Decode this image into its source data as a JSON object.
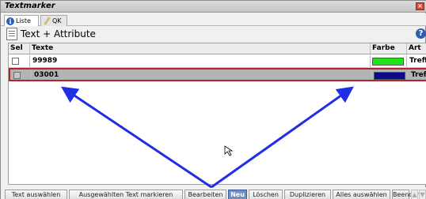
{
  "window": {
    "title": "Textmarker"
  },
  "tabs": [
    {
      "label": "Liste",
      "icon": "info-icon"
    },
    {
      "label": "QK",
      "icon": "pen-icon"
    }
  ],
  "header": {
    "title": "Text + Attribute"
  },
  "table": {
    "columns": [
      "Sel",
      "Texte",
      "Farbe",
      "Art"
    ],
    "rows": [
      {
        "text": "99989",
        "color": "#22e21a",
        "art": "Treffer",
        "selected": false
      },
      {
        "text": "03001",
        "color": "#0a0a8c",
        "art": "Treffer",
        "selected": true
      }
    ]
  },
  "toolbar": {
    "buttons": [
      {
        "label": "Text auswählen"
      },
      {
        "label": "Ausgewählten Text markieren"
      },
      {
        "label": "Bearbeiten"
      },
      {
        "label": "Neu"
      },
      {
        "label": "Löschen"
      },
      {
        "label": "Duplizieren"
      },
      {
        "label": "Alles auswählen"
      },
      {
        "label": "Beenden"
      }
    ]
  },
  "annotation": {
    "arrow_color": "#1f2fe6"
  }
}
